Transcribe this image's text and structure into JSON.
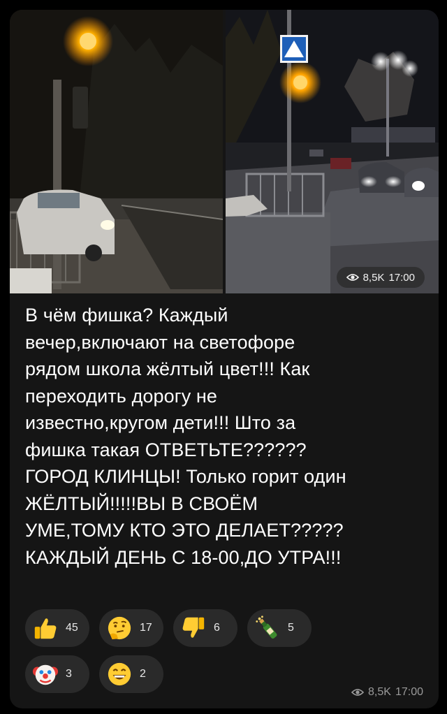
{
  "media": {
    "views": "8,5K",
    "time": "17:00"
  },
  "message": {
    "lines": [
      "В чём фишка? Каждый",
      "вечер,включают на светофоре",
      "рядом школа жёлтый цвет!!! Как",
      "переходить дорогу не",
      "известно,кругом дети!!! Што за",
      "фишка такая ОТВЕТЬТЕ??????",
      "ГОРОД КЛИНЦЫ! Только горит один",
      "ЖЁЛТЫЙ!!!!!ВЫ В СВОЁМ",
      "УМЕ,ТОМУ КТО ЭТО ДЕЛАЕТ?????",
      "КАЖДЫЙ ДЕНЬ С 18-00,ДО УТРА!!!"
    ]
  },
  "reactions": [
    {
      "icon": "thumbs-up-icon",
      "count": "45"
    },
    {
      "icon": "thinking-face-icon",
      "count": "17"
    },
    {
      "icon": "thumbs-down-icon",
      "count": "6"
    },
    {
      "icon": "champagne-icon",
      "count": "5"
    },
    {
      "icon": "clown-face-icon",
      "count": "3"
    },
    {
      "icon": "grinning-face-icon",
      "count": "2"
    }
  ],
  "footer": {
    "views": "8,5K",
    "time": "17:00"
  }
}
